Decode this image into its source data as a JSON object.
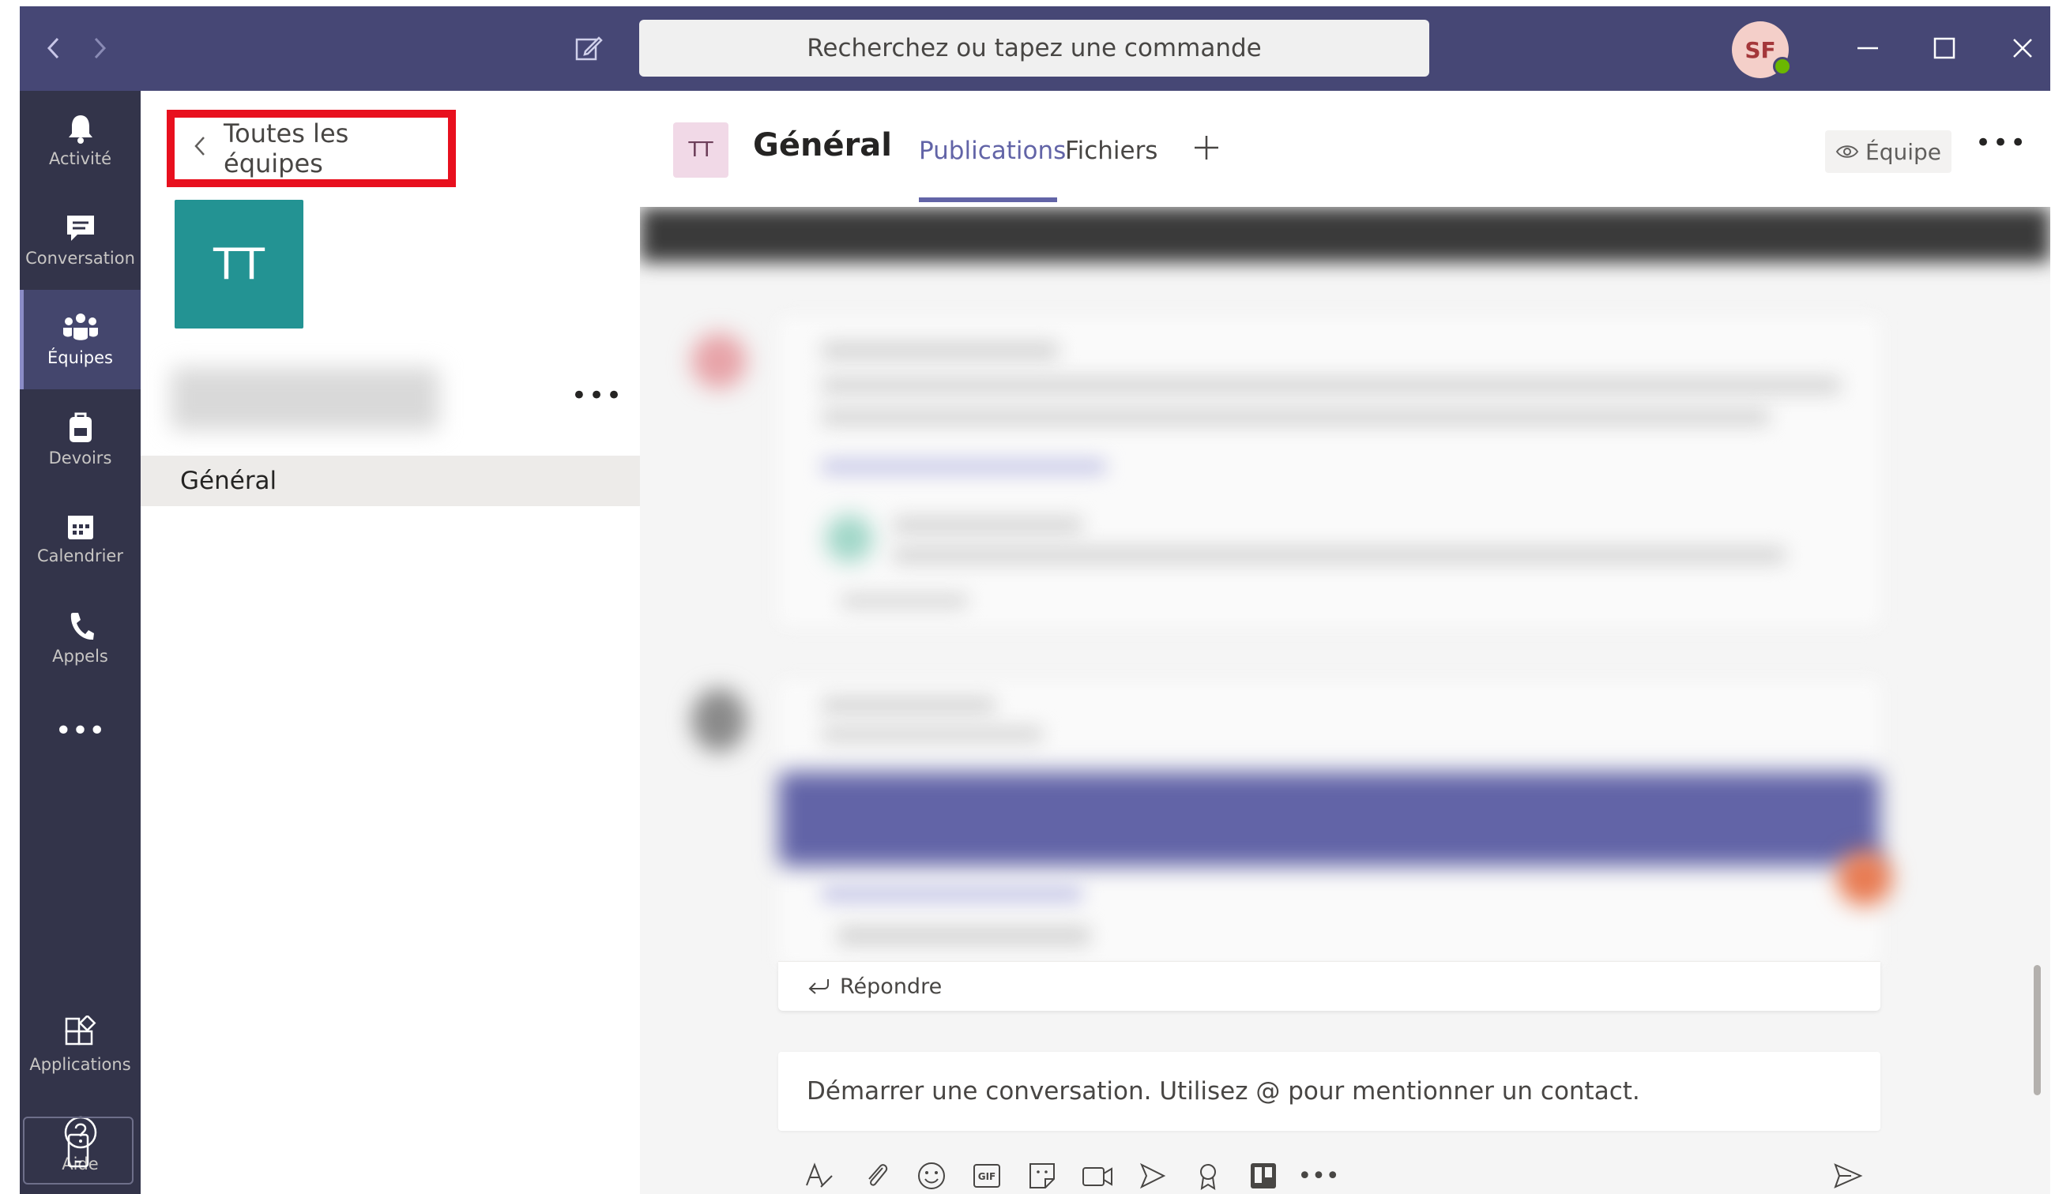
{
  "titlebar": {
    "search_placeholder": "Recherchez ou tapez une commande",
    "avatar_initials": "SF",
    "presence_color": "#6bb700"
  },
  "rail": {
    "items": [
      {
        "label": "Activité",
        "icon": "bell-icon"
      },
      {
        "label": "Conversation",
        "icon": "chat-icon"
      },
      {
        "label": "Équipes",
        "icon": "teams-icon",
        "active": true
      },
      {
        "label": "Devoirs",
        "icon": "backpack-icon"
      },
      {
        "label": "Calendrier",
        "icon": "calendar-icon"
      },
      {
        "label": "Appels",
        "icon": "phone-icon"
      },
      {
        "label": "",
        "icon": "more-icon"
      }
    ],
    "bottom_items": [
      {
        "label": "Applications",
        "icon": "apps-icon"
      },
      {
        "label": "Aide",
        "icon": "help-icon"
      }
    ],
    "device_icon": "mobile-device-icon"
  },
  "teams_panel": {
    "back_label": "Toutes les équipes",
    "team_initials": "TT",
    "team_color": "#239393",
    "channel": "Général"
  },
  "channel_header": {
    "avatar_initials": "TT",
    "title": "Général",
    "tabs": [
      "Publications",
      "Fichiers"
    ],
    "active_tab": "Publications",
    "team_button": "Équipe"
  },
  "conversation": {
    "reply_label": "Répondre",
    "compose_placeholder": "Démarrer une conversation. Utilisez @ pour mentionner un contact."
  },
  "colors": {
    "titlebar": "#464775",
    "rail": "#33344a",
    "accent": "#6264a7",
    "highlight_border": "#e8101e"
  }
}
